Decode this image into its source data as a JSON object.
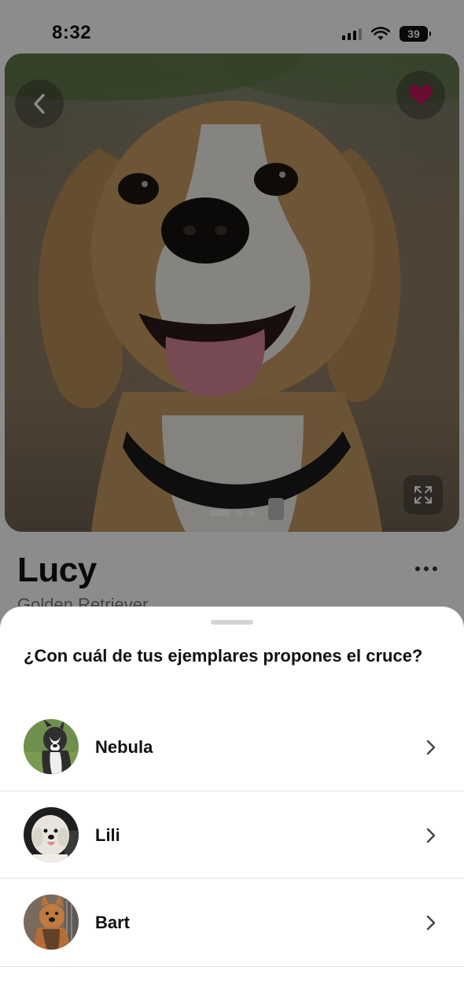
{
  "status_bar": {
    "time": "8:32",
    "battery": "39"
  },
  "pet": {
    "name": "Lucy",
    "breed": "Golden Retriever"
  },
  "hero": {
    "photo": "beagle-photo",
    "icons": [
      "chevron-left-icon",
      "heart-icon",
      "expand-icon"
    ],
    "heart_color": "#c2185b",
    "page_count": 3,
    "active_page": 1
  },
  "sheet": {
    "title": "¿Con cuál de tus ejemplares propones el cruce?",
    "options": [
      {
        "label": "Nebula"
      },
      {
        "label": "Lili"
      },
      {
        "label": "Bart"
      }
    ]
  },
  "colors": {
    "overlay": "#000000",
    "sheet_bg": "#ffffff",
    "divider": "#e6e6e6"
  }
}
